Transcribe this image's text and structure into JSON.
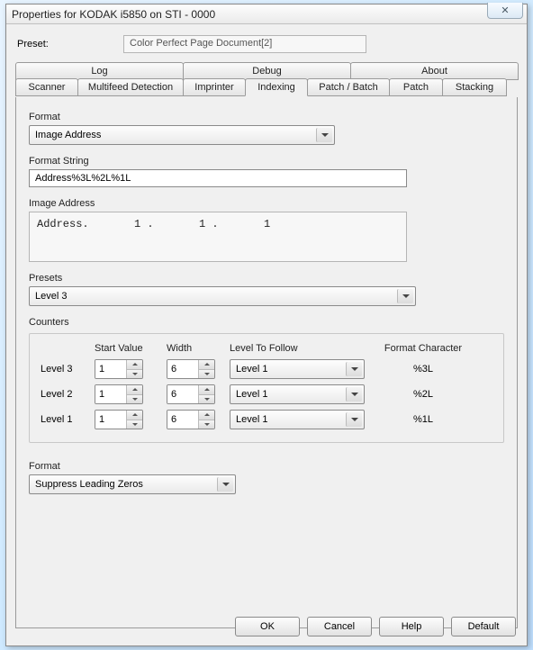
{
  "window": {
    "title": "Properties for KODAK i5850 on STI - 0000"
  },
  "preset": {
    "label": "Preset:",
    "value": "Color Perfect Page Document[2]"
  },
  "tabs": {
    "row1": [
      "Log",
      "Debug",
      "About"
    ],
    "row2": [
      "Scanner",
      "Multifeed Detection",
      "Imprinter",
      "Indexing",
      "Patch / Batch",
      "Patch",
      "Stacking"
    ],
    "active": "Indexing"
  },
  "indexing": {
    "format_label": "Format",
    "format_value": "Image Address",
    "format_string_label": "Format String",
    "format_string_value": "Address%3L%2L%1L",
    "image_address_label": "Image Address",
    "image_address_preview": "Address.       1 .       1 .       1",
    "presets_label": "Presets",
    "presets_value": "Level 3",
    "counters_label": "Counters",
    "counters": {
      "headers": {
        "start": "Start Value",
        "width": "Width",
        "ltf": "Level To Follow",
        "fmt": "Format Character"
      },
      "rows": [
        {
          "label": "Level 3",
          "start": "1",
          "width": "6",
          "ltf": "Level 1",
          "fmt": "%3L"
        },
        {
          "label": "Level 2",
          "start": "1",
          "width": "6",
          "ltf": "Level 1",
          "fmt": "%2L"
        },
        {
          "label": "Level 1",
          "start": "1",
          "width": "6",
          "ltf": "Level 1",
          "fmt": "%1L"
        }
      ]
    },
    "format2_label": "Format",
    "format2_value": "Suppress Leading Zeros"
  },
  "buttons": {
    "ok": "OK",
    "cancel": "Cancel",
    "help": "Help",
    "default": "Default"
  }
}
